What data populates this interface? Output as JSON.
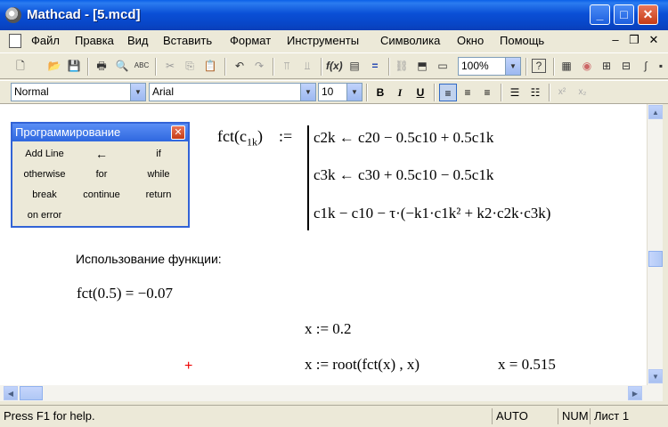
{
  "window": {
    "title": "Mathcad - [5.mcd]"
  },
  "menu": {
    "items": [
      "Файл",
      "Правка",
      "Вид",
      "Вставить",
      "Формат",
      "Инструменты",
      "Символика",
      "Окно",
      "Помощь"
    ]
  },
  "toolbar": {
    "zoom": "100%"
  },
  "format_bar": {
    "style": "Normal",
    "font": "Arial",
    "size": "10",
    "bold": "B",
    "italic": "I",
    "underline": "U"
  },
  "palette": {
    "title": "Программирование",
    "buttons": [
      "Add Line",
      "←",
      "if",
      "otherwise",
      "for",
      "while",
      "break",
      "continue",
      "return",
      "on error"
    ]
  },
  "worksheet": {
    "func_def_lhs": "fct(c",
    "func_def_sub": "1k",
    "assign": ":=",
    "line1": "c2k ← c20 − 0.5c10 + 0.5c1k",
    "line2": "c3k ← c30 + 0.5c10 − 0.5c1k",
    "line3": "c1k − c10 − τ·(−k1·c1k² + k2·c2k·c3k)",
    "usage_text": "Использование функции:",
    "eval_expr": "fct(0.5)",
    "eval_result": "−0.07",
    "x_def": "x := 0.2",
    "root_def": "x := root(fct(x) , x)",
    "x_result": "x = 0.515",
    "cursor": "+"
  },
  "status": {
    "help": "Press F1 for help.",
    "auto": "AUTO",
    "num": "NUM",
    "page": "Лист 1"
  },
  "colors": {
    "title_bar": "#0a4fd6",
    "close_button": "#c63c16",
    "cursor": "#e00000"
  }
}
